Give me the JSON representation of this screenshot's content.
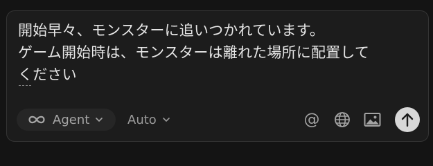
{
  "message": {
    "lines": [
      "開始早々、モンスターに追いつかれています。",
      "ゲーム開始時は、モンスターは離れた場所に配置して"
    ],
    "last_line": "ください"
  },
  "toolbar": {
    "agent_label": "Agent",
    "agent_icon": "infinity-icon",
    "auto_label": "Auto",
    "mention_symbol": "@",
    "icons": [
      "globe-icon",
      "image-icon",
      "arrow-up-icon"
    ]
  },
  "colors": {
    "background": "#141414",
    "panel": "#1c1c1c",
    "text": "#e6e6e6",
    "muted": "#a6a6a6",
    "send_button": "#d8d8d8"
  }
}
